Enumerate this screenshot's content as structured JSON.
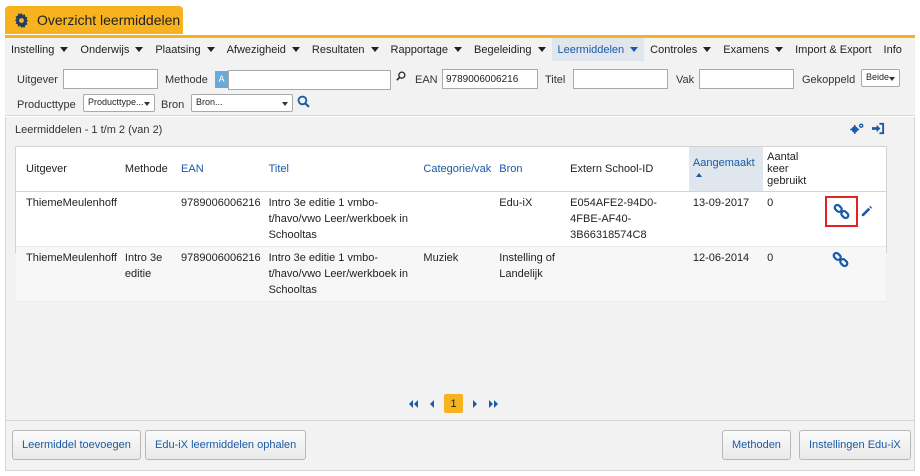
{
  "tab": {
    "title": "Overzicht leermiddelen"
  },
  "menu": [
    {
      "label": "Instelling",
      "dropdown": true,
      "active": false
    },
    {
      "label": "Onderwijs",
      "dropdown": true,
      "active": false
    },
    {
      "label": "Plaatsing",
      "dropdown": true,
      "active": false
    },
    {
      "label": "Afwezigheid",
      "dropdown": true,
      "active": false
    },
    {
      "label": "Resultaten",
      "dropdown": true,
      "active": false
    },
    {
      "label": "Rapportage",
      "dropdown": true,
      "active": false
    },
    {
      "label": "Begeleiding",
      "dropdown": true,
      "active": false
    },
    {
      "label": "Leermiddelen",
      "dropdown": true,
      "active": true
    },
    {
      "label": "Controles",
      "dropdown": true,
      "active": false
    },
    {
      "label": "Examens",
      "dropdown": true,
      "active": false
    },
    {
      "label": "Import & Export",
      "dropdown": false,
      "active": false
    },
    {
      "label": "Info",
      "dropdown": false,
      "active": false
    }
  ],
  "filters": {
    "uitgever_label": "Uitgever",
    "uitgever_value": "",
    "methode_label": "Methode",
    "methode_value": "",
    "ean_label": "EAN",
    "ean_value": "9789006006216",
    "titel_label": "Titel",
    "titel_value": "",
    "vak_label": "Vak",
    "vak_value": "",
    "gekoppeld_label": "Gekoppeld",
    "gekoppeld_value": "Beide",
    "producttype_label": "Producttype",
    "producttype_value": "Producttype...",
    "bron_label": "Bron",
    "bron_value": "Bron..."
  },
  "panel": {
    "title": "Leermiddelen - 1 t/m 2 (van 2)"
  },
  "table": {
    "headers": {
      "uitgever": "Uitgever",
      "methode": "Methode",
      "ean": "EAN",
      "titel": "Titel",
      "categorie": "Categorie/vak",
      "bron": "Bron",
      "extern": "Extern School-ID",
      "aangemaakt": "Aangemaakt",
      "aantal": "Aantal keer gebruikt"
    },
    "rows": [
      {
        "uitgever": "ThiemeMeulenhoff",
        "methode": "",
        "ean": "9789006006216",
        "titel": "Intro 3e editie 1 vmbo-t/havo/vwo Leer/werkboek in Schooltas",
        "categorie": "",
        "bron": "Edu-iX",
        "extern": "E054AFE2-94D0-4FBE-AF40-3B66318574C8",
        "aangemaakt": "13-09-2017",
        "aantal": "0"
      },
      {
        "uitgever": "ThiemeMeulenhoff",
        "methode": "Intro 3e editie",
        "ean": "9789006006216",
        "titel": "Intro 3e editie 1 vmbo-t/havo/vwo Leer/werkboek in Schooltas",
        "categorie": "Muziek",
        "bron": "Instelling of Landelijk",
        "extern": "",
        "aangemaakt": "12-06-2014",
        "aantal": "0"
      }
    ]
  },
  "pager": {
    "current_page": "1"
  },
  "buttons": {
    "add": "Leermiddel toevoegen",
    "fetch": "Edu-iX leermiddelen ophalen",
    "methods": "Methoden",
    "settings": "Instellingen Edu-iX"
  },
  "colors": {
    "accent": "#f6b21f",
    "link": "#1a5aa6",
    "highlight": "#e02424"
  }
}
